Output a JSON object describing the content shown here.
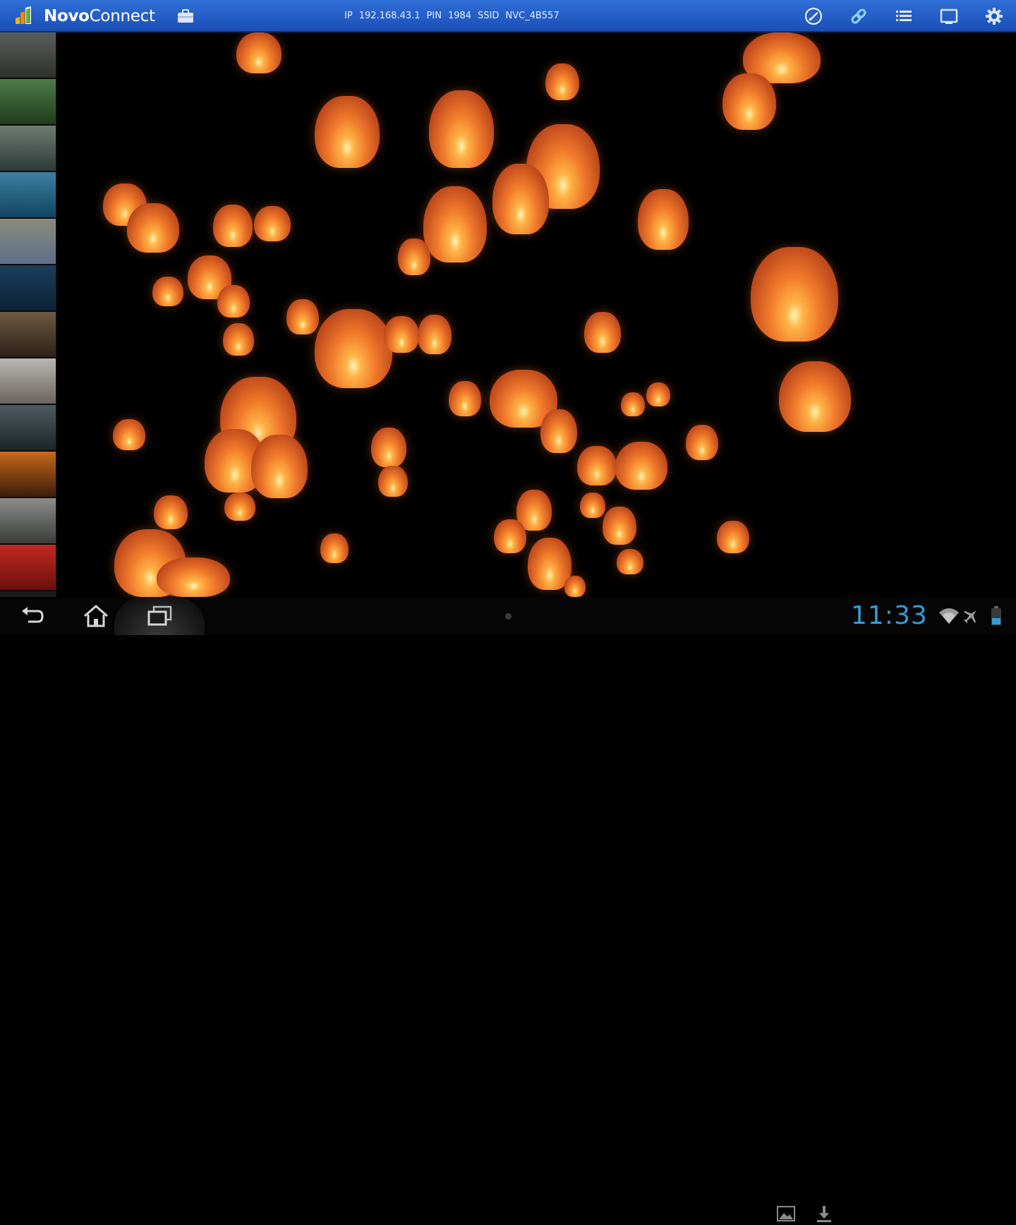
{
  "app": {
    "title_bold": "Novo",
    "title_rest": "Connect"
  },
  "connection": {
    "ip_label": "IP",
    "ip_value": "192.168.43.1",
    "pin_label": "PIN",
    "pin_value": "1984",
    "ssid_label": "SSID",
    "ssid_value": "NVC_4B557"
  },
  "toolbar": {
    "icons": [
      "presenter-icon",
      "link-icon",
      "list-icon",
      "screen-icon",
      "settings-icon"
    ]
  },
  "sidebar": {
    "thumbnails": [
      {
        "name": "thumbnail-1",
        "colors": [
          "#5a5f5a",
          "#2e302c"
        ]
      },
      {
        "name": "thumbnail-2",
        "colors": [
          "#4f7a4a",
          "#1f3d1c"
        ]
      },
      {
        "name": "thumbnail-3",
        "colors": [
          "#6f7c72",
          "#2c3a38"
        ]
      },
      {
        "name": "thumbnail-4",
        "colors": [
          "#3f7fa2",
          "#104560"
        ]
      },
      {
        "name": "thumbnail-5",
        "colors": [
          "#8a8b7a",
          "#5d6f89"
        ]
      },
      {
        "name": "thumbnail-6",
        "colors": [
          "#1b3f5c",
          "#0b2236"
        ]
      },
      {
        "name": "thumbnail-7",
        "colors": [
          "#6e5a42",
          "#2b2016"
        ]
      },
      {
        "name": "thumbnail-8",
        "colors": [
          "#b9b6b2",
          "#6b6460"
        ]
      },
      {
        "name": "thumbnail-9",
        "colors": [
          "#4e5b60",
          "#1c2528"
        ]
      },
      {
        "name": "thumbnail-10",
        "colors": [
          "#c66a1c",
          "#3b1d0a"
        ]
      },
      {
        "name": "thumbnail-11",
        "colors": [
          "#8b8d88",
          "#3a3d3b"
        ]
      },
      {
        "name": "thumbnail-12",
        "colors": [
          "#c22a22",
          "#6b0f0c"
        ]
      }
    ]
  },
  "status": {
    "time": "11:33"
  },
  "colors": {
    "topbar": "#1b4fb8",
    "clock": "#2f9fd8",
    "lantern": "#f07a2a"
  }
}
